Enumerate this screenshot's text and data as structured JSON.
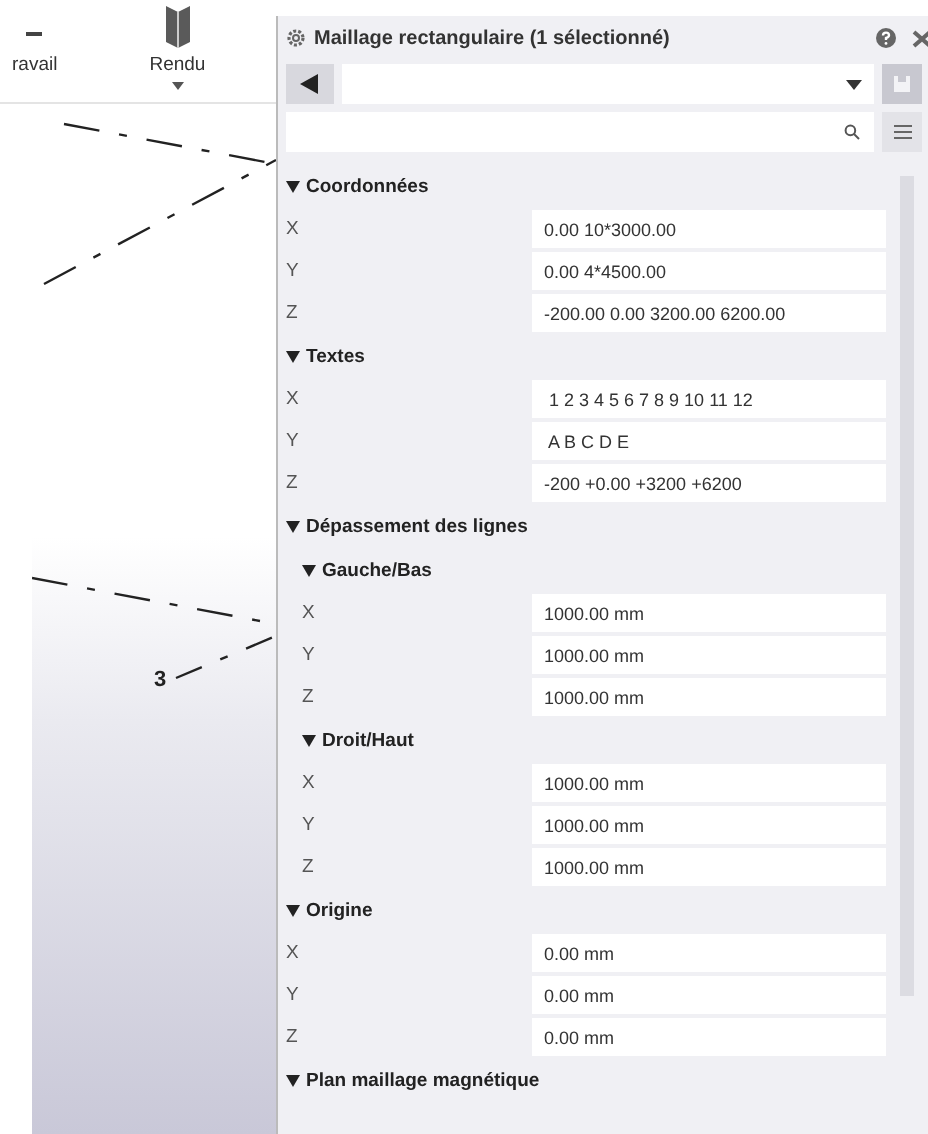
{
  "ribbon": {
    "items": [
      {
        "label": "ravail",
        "dropdown": false
      },
      {
        "label": "Rendu",
        "dropdown": true
      }
    ]
  },
  "canvas": {
    "labels": [
      "3"
    ]
  },
  "panel": {
    "title": "Maillage rectangulaire (1 sélectionné)",
    "sections": [
      {
        "title": "Coordonnées",
        "expanded": true,
        "rows": [
          {
            "label": "X",
            "value": "0.00 10*3000.00"
          },
          {
            "label": "Y",
            "value": "0.00 4*4500.00"
          },
          {
            "label": "Z",
            "value": "-200.00 0.00 3200.00 6200.00"
          }
        ]
      },
      {
        "title": "Textes",
        "expanded": true,
        "rows": [
          {
            "label": "X",
            "value": " 1 2 3 4 5 6 7 8 9 10 11 12"
          },
          {
            "label": "Y",
            "value": " A B C D E"
          },
          {
            "label": "Z",
            "value": "-200 +0.00 +3200 +6200"
          }
        ]
      },
      {
        "title": "Dépassement des lignes",
        "expanded": true,
        "children": [
          {
            "title": "Gauche/Bas",
            "expanded": true,
            "rows": [
              {
                "label": "X",
                "value": "1000.00 mm"
              },
              {
                "label": "Y",
                "value": "1000.00 mm"
              },
              {
                "label": "Z",
                "value": "1000.00 mm"
              }
            ]
          },
          {
            "title": "Droit/Haut",
            "expanded": true,
            "rows": [
              {
                "label": "X",
                "value": "1000.00 mm"
              },
              {
                "label": "Y",
                "value": "1000.00 mm"
              },
              {
                "label": "Z",
                "value": "1000.00 mm"
              }
            ]
          }
        ]
      },
      {
        "title": "Origine",
        "expanded": true,
        "rows": [
          {
            "label": "X",
            "value": "0.00 mm"
          },
          {
            "label": "Y",
            "value": "0.00 mm"
          },
          {
            "label": "Z",
            "value": "0.00 mm"
          }
        ]
      },
      {
        "title": "Plan maillage magnétique",
        "expanded": true
      }
    ]
  }
}
